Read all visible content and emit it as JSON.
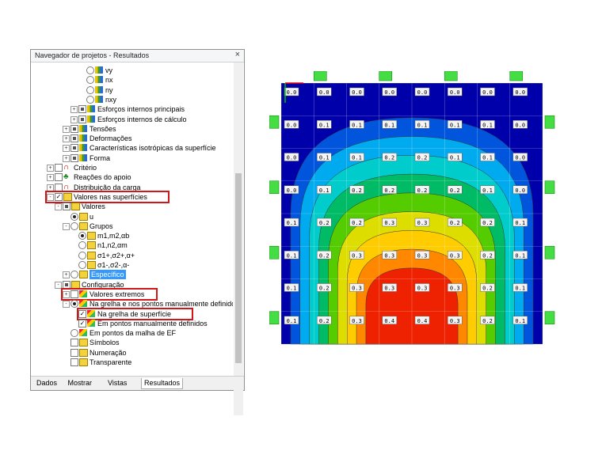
{
  "navigator": {
    "title": "Navegador de projetos - Resultados",
    "close_glyph": "×",
    "items": [
      {
        "label": "vy",
        "indent": 6,
        "exp": "",
        "cb": "",
        "rb": "off",
        "icon": "grid"
      },
      {
        "label": "nx",
        "indent": 6,
        "exp": "",
        "cb": "",
        "rb": "off",
        "icon": "grid"
      },
      {
        "label": "ny",
        "indent": 6,
        "exp": "",
        "cb": "",
        "rb": "off",
        "icon": "grid"
      },
      {
        "label": "nxy",
        "indent": 6,
        "exp": "",
        "cb": "",
        "rb": "off",
        "icon": "grid"
      },
      {
        "label": "Esforços internos principais",
        "indent": 5,
        "exp": "+",
        "cb": "part",
        "rb": "",
        "icon": "grid"
      },
      {
        "label": "Esforços internos de cálculo",
        "indent": 5,
        "exp": "+",
        "cb": "part",
        "rb": "",
        "icon": "grid"
      },
      {
        "label": "Tensões",
        "indent": 4,
        "exp": "+",
        "cb": "part",
        "rb": "",
        "icon": "grid"
      },
      {
        "label": "Deformações",
        "indent": 4,
        "exp": "+",
        "cb": "part",
        "rb": "",
        "icon": "grid"
      },
      {
        "label": "Características isotrópicas da superfície",
        "indent": 4,
        "exp": "+",
        "cb": "part",
        "rb": "",
        "icon": "grid"
      },
      {
        "label": "Forma",
        "indent": 4,
        "exp": "+",
        "cb": "part",
        "rb": "",
        "icon": "grid"
      },
      {
        "label": "Critério",
        "indent": 2,
        "exp": "+",
        "cb": "empty",
        "rb": "",
        "icon": "red"
      },
      {
        "label": "Reações do apoio",
        "indent": 2,
        "exp": "+",
        "cb": "empty",
        "rb": "",
        "icon": "green"
      },
      {
        "label": "Distribuição da carga",
        "indent": 2,
        "exp": "+",
        "cb": "empty",
        "rb": "",
        "icon": "red"
      },
      {
        "label": "Valores nas superfícies",
        "indent": 2,
        "exp": "-",
        "cb": "checked",
        "rb": "",
        "icon": "yellow"
      },
      {
        "label": "Valores",
        "indent": 3,
        "exp": "-",
        "cb": "part",
        "rb": "",
        "icon": "yellow"
      },
      {
        "label": "u",
        "indent": 4,
        "exp": "",
        "cb": "",
        "rb": "on",
        "icon": "yellow"
      },
      {
        "label": "Grupos",
        "indent": 4,
        "exp": "-",
        "cb": "",
        "rb": "off",
        "icon": "yellow"
      },
      {
        "label": "m1,m2,αb",
        "indent": 5,
        "exp": "",
        "cb": "",
        "rb": "on",
        "icon": "yellow"
      },
      {
        "label": "n1,n2,αm",
        "indent": 5,
        "exp": "",
        "cb": "",
        "rb": "off",
        "icon": "yellow"
      },
      {
        "label": "σ1+,σ2+,α+",
        "indent": 5,
        "exp": "",
        "cb": "",
        "rb": "off",
        "icon": "yellow"
      },
      {
        "label": "σ1-,σ2-,α-",
        "indent": 5,
        "exp": "",
        "cb": "",
        "rb": "off",
        "icon": "yellow"
      },
      {
        "label": "Específico",
        "indent": 4,
        "exp": "+",
        "cb": "",
        "rb": "off",
        "icon": "yellow",
        "selected": true
      },
      {
        "label": "Configuração",
        "indent": 3,
        "exp": "-",
        "cb": "part",
        "rb": "",
        "icon": "yellow"
      },
      {
        "label": "Valores extremos",
        "indent": 4,
        "exp": "+",
        "cb": "empty",
        "rb": "",
        "icon": "multi"
      },
      {
        "label": "Na grelha e nos pontos manualmente definidos",
        "indent": 4,
        "exp": "-",
        "cb": "",
        "rb": "on",
        "icon": "multi"
      },
      {
        "label": "Na grelha de superfície",
        "indent": 5,
        "exp": "",
        "cb": "checked",
        "rb": "",
        "icon": "multi"
      },
      {
        "label": "Em pontos manualmente definidos",
        "indent": 5,
        "exp": "",
        "cb": "checked",
        "rb": "",
        "icon": "multi"
      },
      {
        "label": "Em pontos da malha de EF",
        "indent": 4,
        "exp": "",
        "cb": "",
        "rb": "off",
        "icon": "multi"
      },
      {
        "label": "Símbolos",
        "indent": 4,
        "exp": "",
        "cb": "empty",
        "rb": "",
        "icon": "yellow"
      },
      {
        "label": "Numeração",
        "indent": 4,
        "exp": "",
        "cb": "empty",
        "rb": "",
        "icon": "yellow"
      },
      {
        "label": "Transparente",
        "indent": 4,
        "exp": "",
        "cb": "empty",
        "rb": "",
        "icon": "yellow"
      }
    ],
    "tabs": [
      {
        "label": "Dados",
        "active": false
      },
      {
        "label": "Mostrar",
        "active": false
      },
      {
        "label": "Vistas",
        "active": false
      },
      {
        "label": "Resultados",
        "active": true
      }
    ]
  },
  "chart_data": {
    "type": "heatmap",
    "title": "",
    "xlabel": "",
    "ylabel": "",
    "columns": 8,
    "rows": 8,
    "values": [
      [
        "0.0",
        "0.0",
        "0.0",
        "0.0",
        "0.0",
        "0.0",
        "0.0",
        "0.0"
      ],
      [
        "0.0",
        "0.1",
        "0.1",
        "0.1",
        "0.1",
        "0.1",
        "0.1",
        "0.0"
      ],
      [
        "0.0",
        "0.1",
        "0.1",
        "0.2",
        "0.2",
        "0.1",
        "0.1",
        "0.0"
      ],
      [
        "0.0",
        "0.1",
        "0.2",
        "0.2",
        "0.2",
        "0.2",
        "0.1",
        "0.0"
      ],
      [
        "0.1",
        "0.2",
        "0.2",
        "0.3",
        "0.3",
        "0.2",
        "0.2",
        "0.1"
      ],
      [
        "0.1",
        "0.2",
        "0.3",
        "0.3",
        "0.3",
        "0.3",
        "0.2",
        "0.1"
      ],
      [
        "0.1",
        "0.2",
        "0.3",
        "0.3",
        "0.3",
        "0.3",
        "0.2",
        "0.1"
      ],
      [
        "0.1",
        "0.2",
        "0.3",
        "0.4",
        "0.4",
        "0.3",
        "0.2",
        "0.1"
      ]
    ],
    "colors": [
      "#0000aa",
      "#0055dd",
      "#00aaee",
      "#00cccc",
      "#00bb66",
      "#55cc00",
      "#dddd00",
      "#ffcc00",
      "#ff8800",
      "#ee2200"
    ]
  }
}
